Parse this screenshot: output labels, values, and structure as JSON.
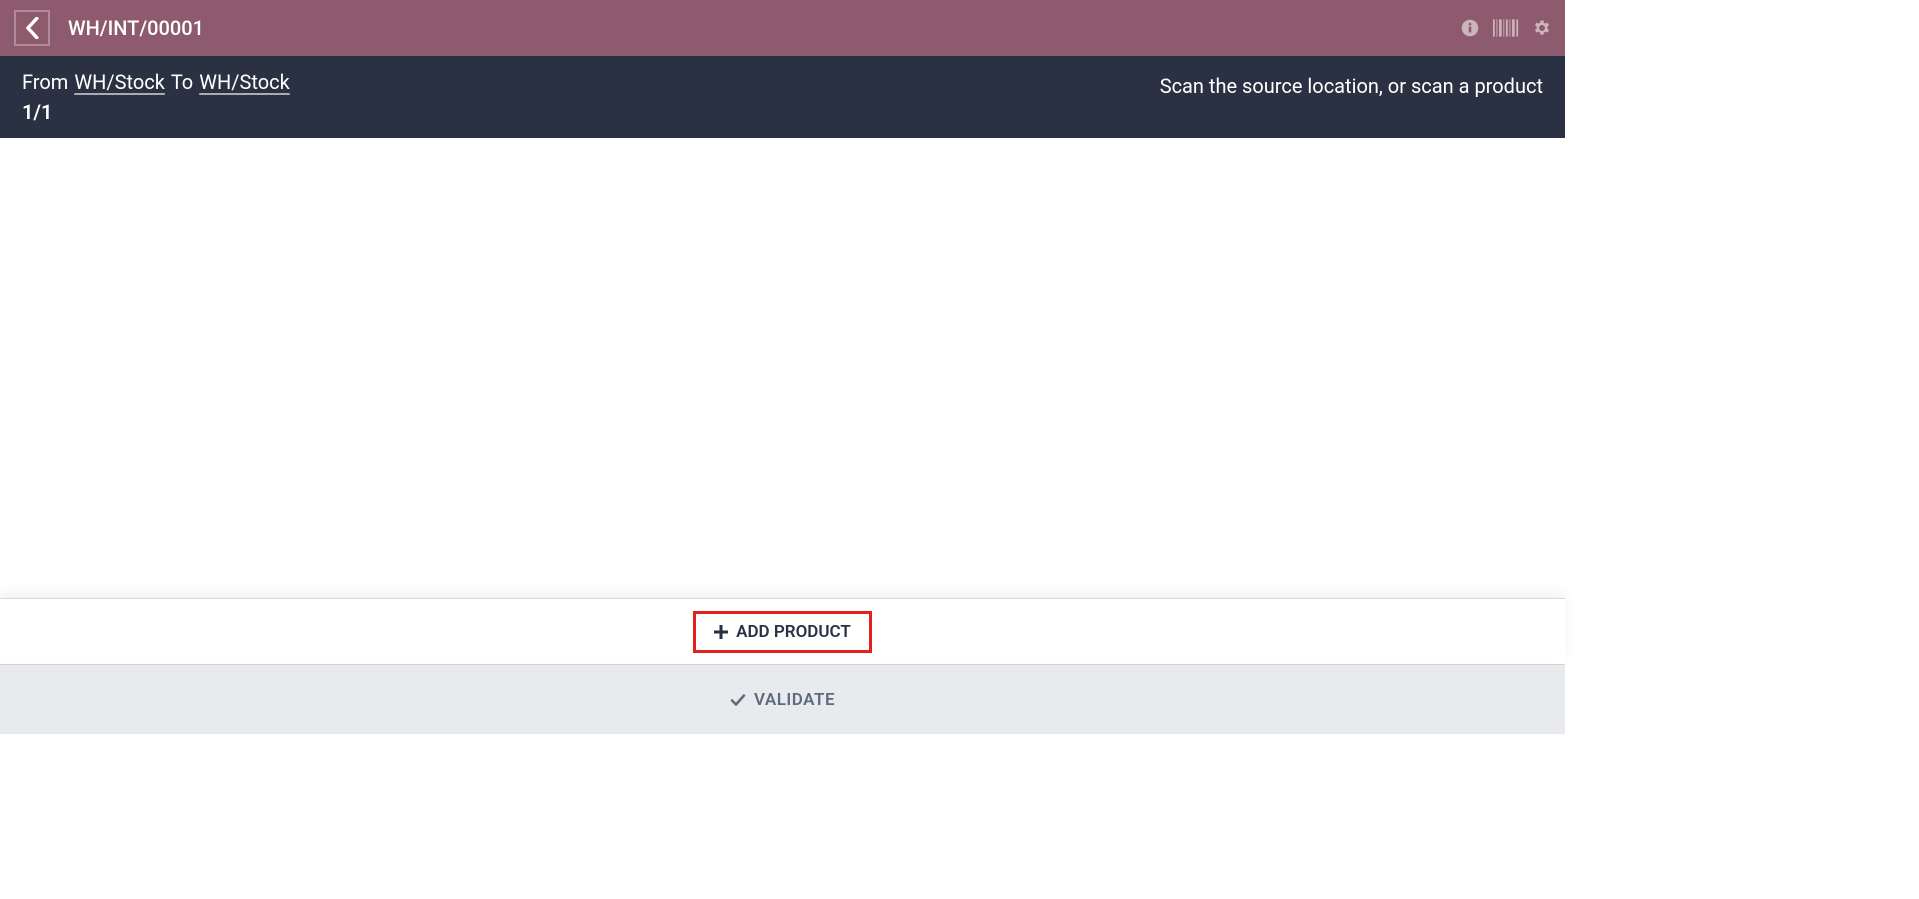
{
  "header": {
    "title": "WH/INT/00001"
  },
  "subheader": {
    "from_label": "From",
    "from_location": "WH/Stock",
    "to_label": "To",
    "to_location": "WH/Stock",
    "counter": "1/1",
    "scan_hint": "Scan the source location, or scan a product"
  },
  "actions": {
    "add_product_label": "ADD PRODUCT",
    "validate_label": "VALIDATE"
  }
}
